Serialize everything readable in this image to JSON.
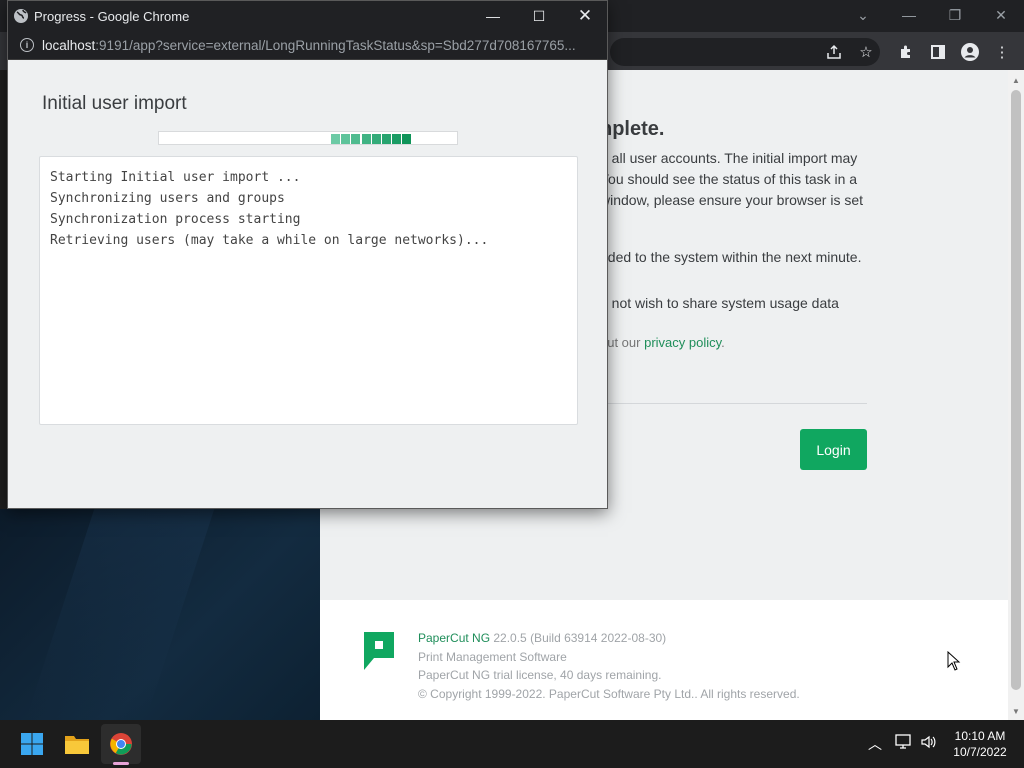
{
  "popup": {
    "title": "Progress - Google Chrome",
    "url_host": "localhost",
    "url_rest": ":9191/app?service=external/LongRunningTaskStatus&sp=Sbd277d708167765...",
    "heading": "Initial user import",
    "progress_colors": [
      "#6ccaa5",
      "#5dc39a",
      "#4fbb8f",
      "#40b384",
      "#33ab79",
      "#27a46f",
      "#1a9c64",
      "#0f9459"
    ],
    "log_lines": [
      "Starting Initial user import ...",
      "Synchronizing users and groups",
      "Synchronization process starting",
      "Retrieving users (may take a while on large networks)..."
    ]
  },
  "background_page": {
    "heading_partial": "nplete.",
    "lines": [
      "g all user accounts. The initial import may",
      "You should see the status of this task in a",
      "window, please ensure your browser is set",
      "dded to the system within the next minute.",
      "o not wish to share system usage data"
    ],
    "privacy_prefix": "out our ",
    "privacy_link": "privacy policy",
    "privacy_suffix": ".",
    "login_button": "Login",
    "footer": {
      "product": "PaperCut NG",
      "version": " 22.0.5 (Build 63914 2022-08-30)",
      "tagline": "Print Management Software",
      "license": "PaperCut NG trial license, 40 days remaining.",
      "copyright": "© Copyright 1999-2022. PaperCut Software Pty Ltd.. All rights reserved."
    }
  },
  "taskbar": {
    "time": "10:10 AM",
    "date": "10/7/2022"
  },
  "colors": {
    "accent_green": "#10a760",
    "link_green": "#1f8e5a"
  }
}
